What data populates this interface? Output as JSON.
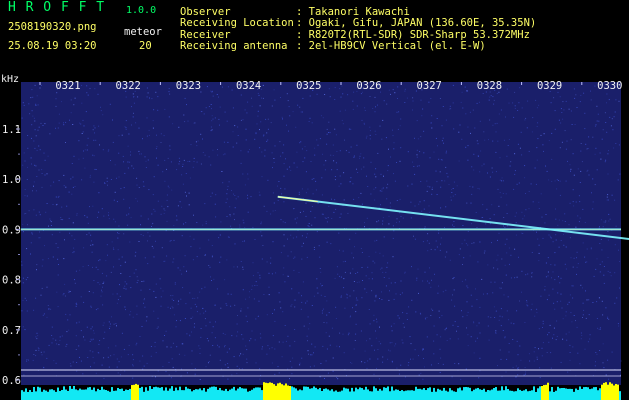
{
  "app": {
    "title": "H R O F F T",
    "version": "1.0.0",
    "filename": "2508190320.png",
    "timestamp": "25.08.19 03:20",
    "meteor_label": "meteor",
    "meteor_count": "20"
  },
  "station": [
    {
      "key": "Observer",
      "value": ": Takanori Kawachi"
    },
    {
      "key": "Receiving Location",
      "value": ": Ogaki, Gifu, JAPAN (136.60E, 35.35N)"
    },
    {
      "key": "Receiver",
      "value": ": R820T2(RTL-SDR) SDR-Sharp 53.372MHz"
    },
    {
      "key": "Receiving antenna",
      "value": ": 2el-HB9CV Vertical (el. E-W)"
    }
  ],
  "colors": {
    "background": "#000000",
    "plot_background": "#1a1f6a",
    "noise_dot": "#3a4dc8",
    "echo": "#7ff7ff",
    "echo_core": "#ffff9a",
    "text": "#f2f2f2",
    "title_color": "#00ff66",
    "filename_color": "#ffff66",
    "meteor_count_color": "#ffff66",
    "baseline": "#e0e0ff",
    "level_fill": "#12e8f4",
    "level_peak": "#ffff00"
  },
  "chart_data": {
    "type": "heatmap",
    "ylabel": "kHz",
    "y_ticks": [
      "1.1",
      "1.0",
      "0.9",
      "0.8",
      "0.7",
      "0.6"
    ],
    "ylim": [
      0.6,
      1.2
    ],
    "x_ticks": [
      "0321",
      "0322",
      "0323",
      "0324",
      "0325",
      "0326",
      "0327",
      "0328",
      "0329",
      "0330"
    ],
    "carrier_khz": 0.9,
    "echoes": [
      {
        "start_min": 3.95,
        "end_min": 9.85,
        "khz_start": 0.965,
        "khz_end": 0.88
      }
    ]
  }
}
